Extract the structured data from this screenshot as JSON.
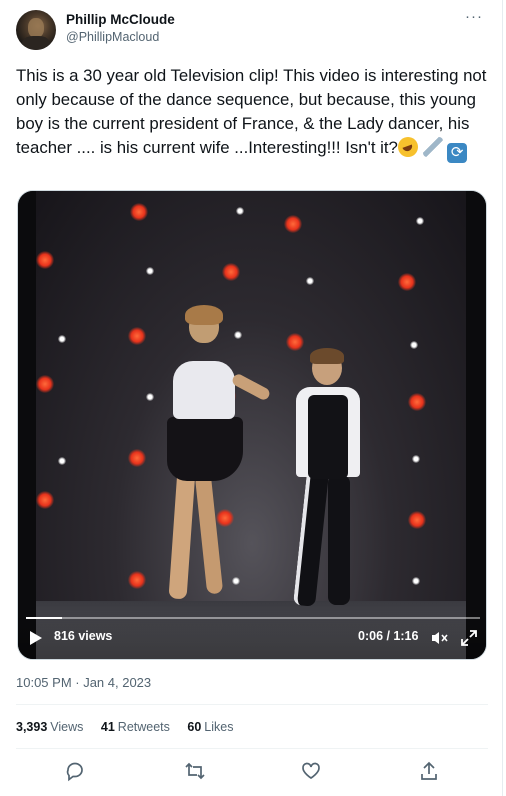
{
  "author": {
    "name": "Phillip McCloude",
    "handle": "@PhillipMacloud"
  },
  "tweet": {
    "text": "This is a 30 year old Television clip! This video is interesting not only because of the dance sequence, but because, this young boy is the current president of France, & the Lady dancer, his teacher .... is his current wife ...Interesting!!! Isn't it?",
    "emojis": [
      "rolling-on-floor-laughing-emoji",
      "syringe-emoji",
      "repeat-button-emoji"
    ]
  },
  "video": {
    "views": "816 views",
    "time": "0:06 / 1:16",
    "progress": 0.08
  },
  "timestamp": "10:05 PM · Jan 4, 2023",
  "stats": {
    "views_count": "3,393",
    "views_label": "Views",
    "retweets_count": "41",
    "retweets_label": "Retweets",
    "likes_count": "60",
    "likes_label": "Likes"
  },
  "actions": [
    "reply-icon",
    "retweet-icon",
    "like-icon",
    "share-icon"
  ],
  "colors": {
    "text": "#0f1419",
    "secondary": "#536471",
    "divider": "#eff3f4"
  }
}
